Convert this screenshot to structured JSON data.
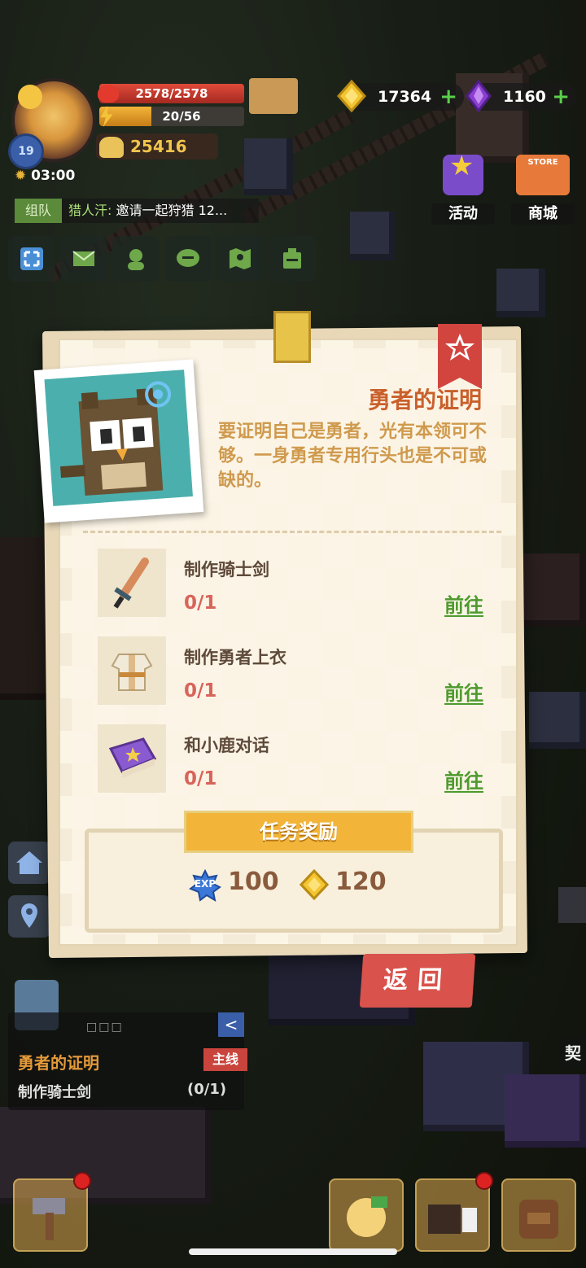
{
  "player": {
    "hp": "2578/2578",
    "exp": "20/56",
    "exp_progress": 0.36,
    "level": "19",
    "power": "25416",
    "timer": "03:00"
  },
  "currency": {
    "gold": "17364",
    "gems": "1160"
  },
  "shop": {
    "activity_label": "活动",
    "store_label": "商城",
    "store_sign": "STORE"
  },
  "chat": {
    "tag": "组队",
    "sender": "猎人汗:",
    "message": "邀请一起狩猎 12..."
  },
  "dialog": {
    "title": "勇者的证明",
    "description": "要证明自己是勇者，光有本领可不够。一身勇者专用行头也是不可或缺的。",
    "tasks": [
      {
        "name": "制作骑士剑",
        "progress": "0/1",
        "go": "前往"
      },
      {
        "name": "制作勇者上衣",
        "progress": "0/1",
        "go": "前往"
      },
      {
        "name": "和小鹿对话",
        "progress": "0/1",
        "go": "前往"
      }
    ],
    "reward_header": "任务奖励",
    "reward_exp_tag": "EXP",
    "reward_exp": "100",
    "reward_gold": "120",
    "back": "返回"
  },
  "tracker": {
    "dots": "□□□",
    "collapse": "<",
    "title": "勇者的证明",
    "tag": "主线",
    "subtask": "制作骑士剑",
    "count": "(0/1)"
  },
  "side_peek": "契",
  "colors": {
    "accent_orange": "#c9602c",
    "go_green": "#4e9a2e",
    "progress_red": "#d8645a",
    "reward_yellow": "#f2b53a",
    "back_red": "#d9524c"
  }
}
